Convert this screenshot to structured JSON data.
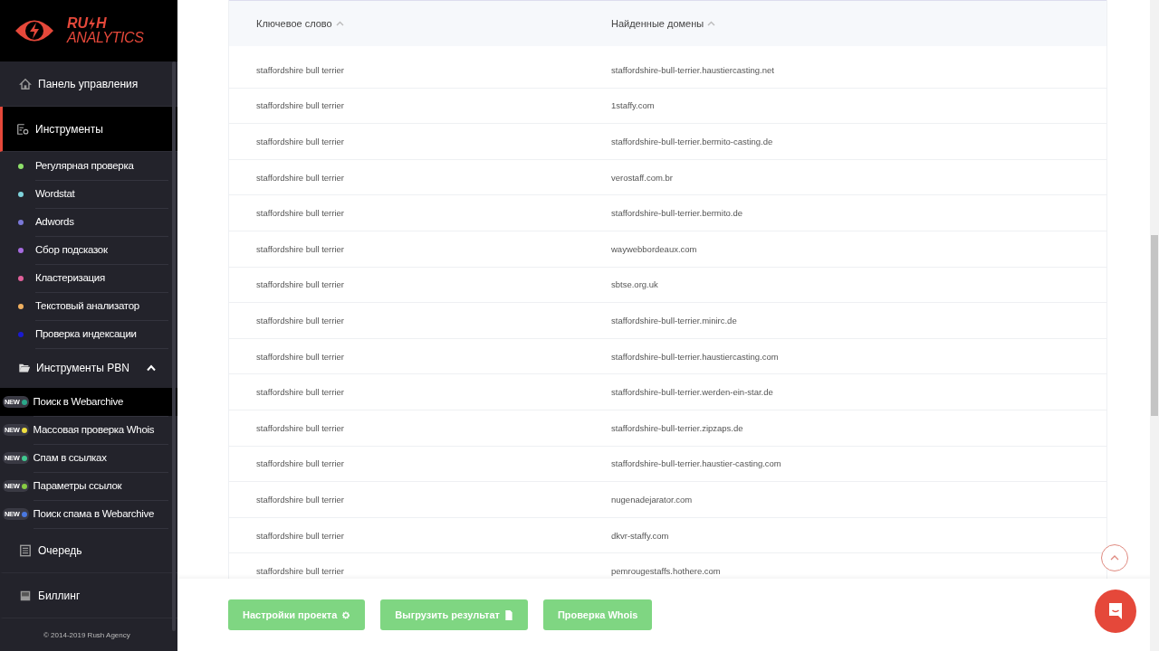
{
  "logo": {
    "part_1": "RU",
    "part_2": "H",
    "subtitle": "ANALYTICS"
  },
  "sidebar": {
    "items": [
      {
        "kind": "main",
        "label": "Панель управления",
        "selected": false
      },
      {
        "kind": "main",
        "label": "Инструменты",
        "selected": true
      },
      {
        "kind": "sub",
        "label": "Регулярная проверка",
        "color": "#8ee06a",
        "selected": false
      },
      {
        "kind": "sub",
        "label": "Wordstat",
        "color": "#7fd3dc",
        "selected": false
      },
      {
        "kind": "sub",
        "label": "Adwords",
        "color": "#7a78d8",
        "selected": false
      },
      {
        "kind": "sub",
        "label": "Сбор подсказок",
        "color": "#a66be0",
        "selected": false
      },
      {
        "kind": "sub",
        "label": "Кластеризация",
        "color": "#e0609a",
        "selected": false
      },
      {
        "kind": "sub",
        "label": "Текстовый анализатор",
        "color": "#f0b060",
        "selected": false
      },
      {
        "kind": "sub",
        "label": "Проверка индексации",
        "color": "#1a1ad0",
        "selected": false
      },
      {
        "kind": "group",
        "label": "Инструменты PBN",
        "expanded": true
      },
      {
        "kind": "new",
        "badge": "NEW",
        "label": "Поиск в Webarchive",
        "color": "#2aa88a",
        "selected": true
      },
      {
        "kind": "new",
        "badge": "NEW",
        "label": "Массовая проверка Whois",
        "color": "#f0e040",
        "selected": false
      },
      {
        "kind": "new",
        "badge": "NEW",
        "label": "Спам в ссылках",
        "color": "#40c890",
        "selected": false
      },
      {
        "kind": "new",
        "badge": "NEW",
        "label": "Параметры ссылок",
        "color": "#88cc44",
        "selected": false
      },
      {
        "kind": "new",
        "badge": "NEW",
        "label": "Поиск спама в Webarchive",
        "color": "#4a78e0",
        "selected": false
      },
      {
        "kind": "main",
        "label": "Очередь",
        "selected": false
      },
      {
        "kind": "main",
        "label": "Биллинг",
        "selected": false
      }
    ]
  },
  "footer": "© 2014-2019 Rush Agency",
  "table": {
    "columns": [
      "Ключевое слово",
      "Найденные домены"
    ],
    "rows": [
      [
        "staffordshire bull terrier",
        "staffordshire-bull-terrier.haustiercasting.net"
      ],
      [
        "staffordshire bull terrier",
        "1staffy.com"
      ],
      [
        "staffordshire bull terrier",
        "staffordshire-bull-terrier.bermito-casting.de"
      ],
      [
        "staffordshire bull terrier",
        "verostaff.com.br"
      ],
      [
        "staffordshire bull terrier",
        "staffordshire-bull-terrier.bermito.de"
      ],
      [
        "staffordshire bull terrier",
        "waywebbordeaux.com"
      ],
      [
        "staffordshire bull terrier",
        "sbtse.org.uk"
      ],
      [
        "staffordshire bull terrier",
        "staffordshire-bull-terrier.minirc.de"
      ],
      [
        "staffordshire bull terrier",
        "staffordshire-bull-terrier.haustiercasting.com"
      ],
      [
        "staffordshire bull terrier",
        "staffordshire-bull-terrier.werden-ein-star.de"
      ],
      [
        "staffordshire bull terrier",
        "staffordshire-bull-terrier.zipzaps.de"
      ],
      [
        "staffordshire bull terrier",
        "staffordshire-bull-terrier.haustier-casting.com"
      ],
      [
        "staffordshire bull terrier",
        "nugenadejarator.com"
      ],
      [
        "staffordshire bull terrier",
        "dkvr-staffy.com"
      ],
      [
        "staffordshire bull terrier",
        "pemrougestaffs.hothere.com"
      ]
    ]
  },
  "actions": [
    {
      "label": "Настройки проекта"
    },
    {
      "label": "Выгрузить результат"
    },
    {
      "label": "Проверка Whois"
    }
  ]
}
